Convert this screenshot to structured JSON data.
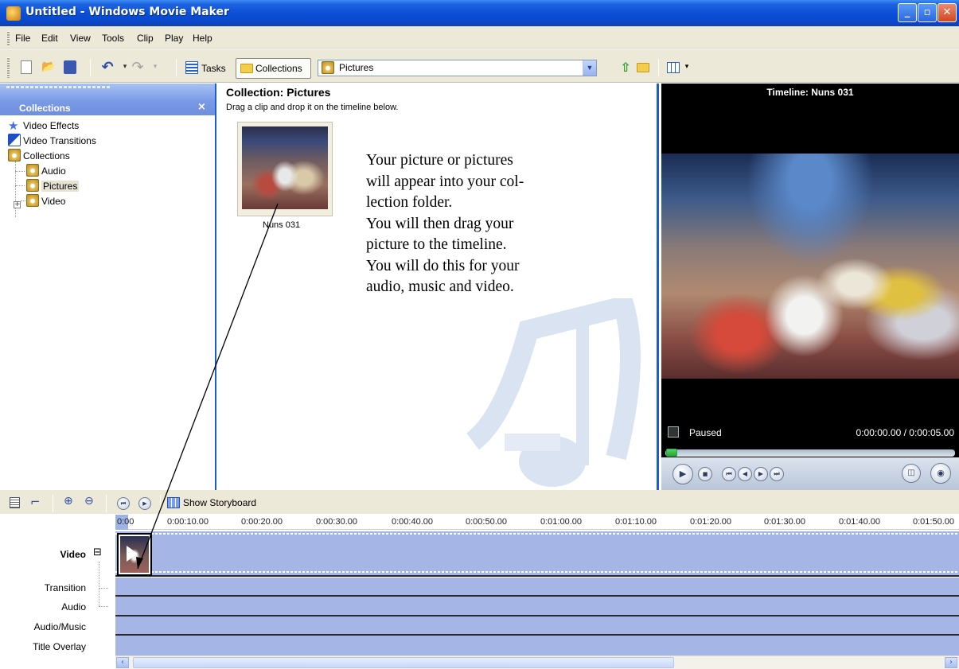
{
  "window": {
    "title": "Untitled - Windows Movie Maker",
    "minimize_glyph": "_",
    "maximize_glyph": "▫",
    "close_glyph": "✕"
  },
  "menu": [
    "File",
    "Edit",
    "View",
    "Tools",
    "Clip",
    "Play",
    "Help"
  ],
  "toolbar": {
    "new_icon": "new-project-icon",
    "open_icon": "open-project-icon",
    "save_icon": "save-icon",
    "undo_icon": "undo-icon",
    "redo_icon": "redo-icon",
    "tasks_label": "Tasks",
    "collections_label": "Collections",
    "collection_select_value": "Pictures",
    "up_icon": "up-one-level-icon",
    "new_folder_icon": "new-folder-icon",
    "views_icon": "views-icon"
  },
  "collections_pane": {
    "title": "Collections",
    "close": "×",
    "items": [
      {
        "label": "Video Effects",
        "icon": "video-effects-icon"
      },
      {
        "label": "Video Transitions",
        "icon": "video-transitions-icon"
      },
      {
        "label": "Collections",
        "icon": "collections-icon"
      },
      {
        "label": "Audio",
        "icon": "collection-folder-icon"
      },
      {
        "label": "Pictures",
        "icon": "collection-folder-icon",
        "selected": true
      },
      {
        "label": "Video",
        "icon": "collection-folder-icon"
      }
    ],
    "expander": "+"
  },
  "collection_view": {
    "title": "Collection: Pictures",
    "hint": "Drag a clip and drop it on the timeline below.",
    "clip_label": "Nuns 031",
    "annotation_lines": [
      "Your picture or pictures",
      "will appear into your col-",
      "lection folder.",
      "You will then drag your",
      "picture to the timeline.",
      "You will do this for your",
      "audio, music and video."
    ]
  },
  "monitor": {
    "title": "Timeline: Nuns 031",
    "status": "Paused",
    "time": "0:00:00.00 / 0:00:05.00",
    "seek_position": 0.0
  },
  "timeline": {
    "show_storyboard": "Show Storyboard",
    "ticks": [
      "0:00",
      "0:00:10.00",
      "0:00:20.00",
      "0:00:30.00",
      "0:00:40.00",
      "0:00:50.00",
      "0:01:00.00",
      "0:01:10.00",
      "0:01:20.00",
      "0:01:30.00",
      "0:01:40.00",
      "0:01:50.00"
    ],
    "tracks": {
      "video": "Video",
      "video_toggle": "⊟",
      "transition": "Transition",
      "audio": "Audio",
      "audio_music": "Audio/Music",
      "title_overlay": "Title Overlay"
    },
    "scroll_left": "‹",
    "scroll_right": "›"
  },
  "colors": {
    "titlebar": "#0a4fd6",
    "pane_border": "#1d5bd0",
    "track_fill": "#a5b6e6",
    "toolbar_bg": "#ece9d8"
  }
}
